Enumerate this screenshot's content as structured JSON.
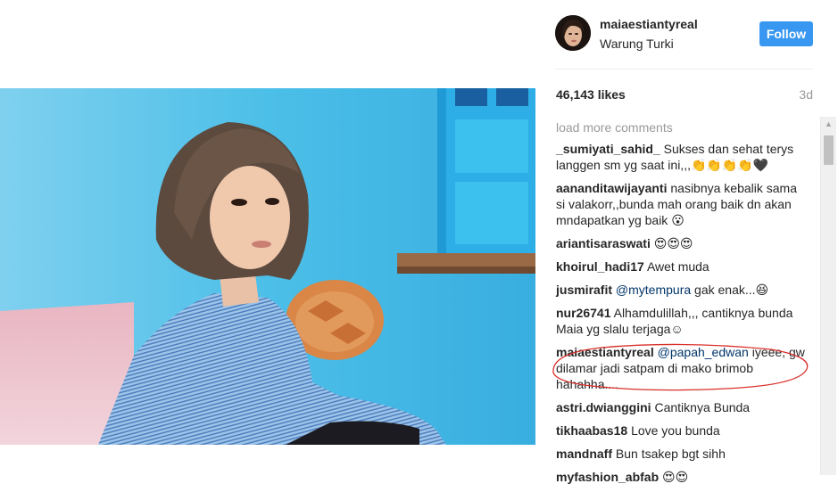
{
  "post": {
    "username": "maiaestiantyreal",
    "location": "Warung Turki",
    "follow_label": "Follow",
    "likes": "46,143 likes",
    "time": "3d",
    "load_more": "load more comments"
  },
  "comments": [
    {
      "user": "_sumiyati_sahid_",
      "text": "Sukses dan sehat terys langgen sm yg saat ini,,,👏👏👏👏🖤"
    },
    {
      "user": "aananditawijayanti",
      "text": "nasibnya kebalik sama si valakorr,,bunda mah orang baik dn akan mndapatkan yg baik 😮"
    },
    {
      "user": "ariantisaraswati",
      "text": "😍😍😍"
    },
    {
      "user": "khoirul_hadi17",
      "text": "Awet muda"
    },
    {
      "user": "jusmirafit",
      "mention": "@mytempura",
      "text": "gak enak...😆"
    },
    {
      "user": "nur26741",
      "text": "Alhamdulillah,,, cantiknya bunda Maia yg slalu terjaga☺"
    },
    {
      "user": "maiaestiantyreal",
      "mention": "@papah_edwan",
      "text": "iyeee, gw dilamar jadi satpam di mako brimob hahahha...."
    },
    {
      "user": "astri.dwianggini",
      "text": "Cantiknya Bunda"
    },
    {
      "user": "tikhaabas18",
      "text": "Love you bunda"
    },
    {
      "user": "mandnaff",
      "text": "Bun tsakep bgt sihh"
    },
    {
      "user": "myfashion_abfab",
      "text": "😍😍"
    }
  ],
  "colors": {
    "follow_button": "#3897f0",
    "wall": "#39b4e0",
    "annotation": "#d9302b"
  },
  "icons": {
    "scroll_up": "scroll-up-arrow-icon"
  }
}
